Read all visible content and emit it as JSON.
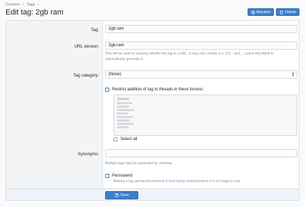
{
  "breadcrumb": {
    "items": [
      "Content",
      "Tags"
    ]
  },
  "page": {
    "title": "Edit tag: 2gb ram"
  },
  "actions": {
    "blacklist_label": "Blacklist",
    "delete_label": "Delete"
  },
  "form": {
    "tag": {
      "label": "Tag:",
      "value": "2gb ram"
    },
    "url_version": {
      "label": "URL version:",
      "value": "2gb-ram",
      "hint": "This will be used to uniquely identify this tag in a URL. It may only contain a-z, 0-9, - and _. Leave this blank to automatically generate it."
    },
    "tag_category": {
      "label": "Tag category:",
      "value": "(None)"
    },
    "restrict": {
      "label": "Restrict addition of tag to threads in these forums:",
      "none_option": "(None)",
      "select_all": "Select all"
    },
    "synonyms": {
      "label": "Synonyms:",
      "value": "",
      "hint": "Multiple tags may be separated by commas."
    },
    "permanent": {
      "label": "Permanent",
      "hint": "Making a tag permanent prevents it from being removed when it is no longer in use."
    }
  },
  "footer": {
    "save_label": "Save"
  },
  "colors": {
    "accent": "#3d7dca",
    "label_column": "#f3f4f6",
    "footer": "#eef3f9"
  }
}
